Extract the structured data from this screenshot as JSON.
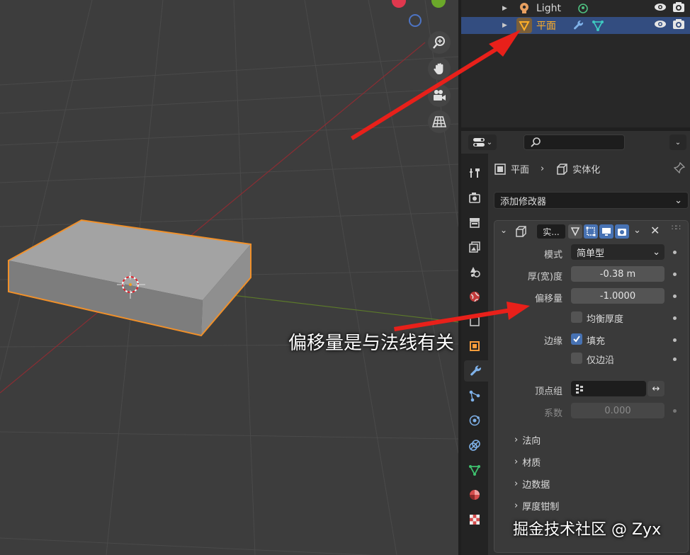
{
  "outliner": {
    "rows": [
      {
        "label": "Light",
        "icon": "light-bulb-icon",
        "extra_icon": "light-data-icon"
      },
      {
        "label": "平面",
        "icon": "mesh-object-icon",
        "extra_icons": [
          "wrench-icon",
          "mesh-data-icon"
        ],
        "selected": true
      }
    ]
  },
  "properties": {
    "search_placeholder": "",
    "breadcrumb": {
      "object": "平面",
      "modifier": "实体化"
    },
    "add_modifier_label": "添加修改器",
    "modifier": {
      "name": "实...",
      "fields": {
        "mode": {
          "label": "模式",
          "value": "简单型"
        },
        "thickness": {
          "label": "厚(宽)度",
          "value": "-0.38 m"
        },
        "offset": {
          "label": "偏移量",
          "value": "-1.0000"
        },
        "even_thickness": {
          "label": "均衡厚度",
          "checked": false
        },
        "rim": {
          "label": "边缘",
          "fill_label": "填充",
          "fill_checked": true,
          "rim_only_label": "仅边沿",
          "rim_only_checked": false
        },
        "vertex_group": {
          "label": "顶点组",
          "value": ""
        },
        "factor": {
          "label": "系数",
          "value": "0.000"
        }
      },
      "subpanels": [
        "法向",
        "材质",
        "边数据",
        "厚度钳制"
      ]
    }
  },
  "annotations": {
    "caption": "偏移量是与法线有关",
    "watermark": "掘金技术社区 @ Zyx"
  },
  "colors": {
    "selection": "#334d80",
    "active_orange": "#ffaf29",
    "accent_blue": "#4772b3",
    "annotation_red": "#e8201a"
  }
}
